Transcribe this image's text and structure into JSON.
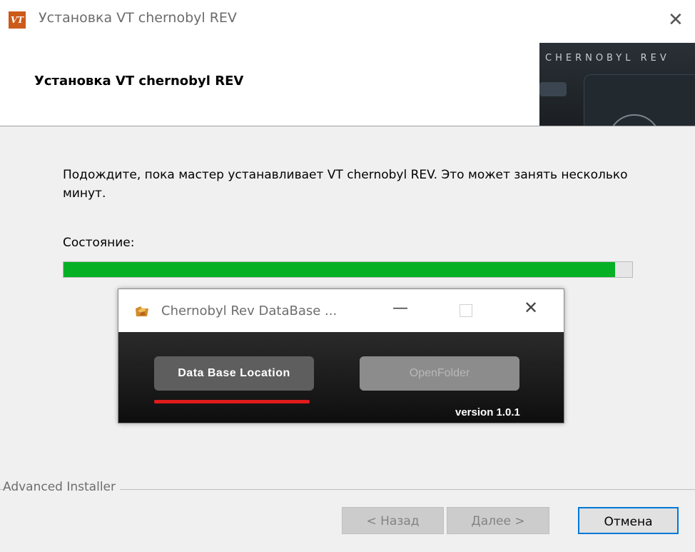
{
  "window": {
    "title": "Установка VT chernobyl REV",
    "icon_text": "VT",
    "close_glyph": "✕"
  },
  "header": {
    "title": "Установка VT chernobyl REV",
    "banner_text": "CHERNOBYL REV"
  },
  "main": {
    "description": "Подождите, пока мастер устанавливает VT chernobyl REV. Это может занять несколько минут.",
    "status_label": "Состояние:",
    "progress_percent": 97
  },
  "dialog": {
    "title": "Chernobyl Rev DataBase ...",
    "minimize_glyph": "—",
    "close_glyph": "✕",
    "db_location_label": "Data Base Location",
    "open_folder_label": "OpenFolder",
    "version": "version 1.0.1"
  },
  "footer": {
    "brand": "Advanced Installer",
    "back_label": "< Назад",
    "next_label": "Далее >",
    "cancel_label": "Отмена"
  },
  "colors": {
    "progress": "#06b025",
    "accent": "#0078d7",
    "underline": "#e01b1b"
  }
}
